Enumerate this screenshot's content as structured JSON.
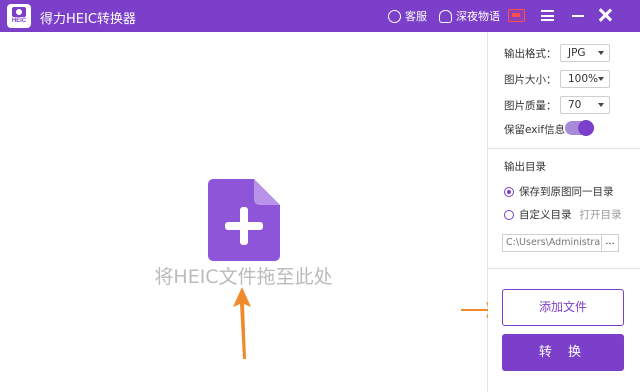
{
  "app": {
    "title": "得力HEIC转换器",
    "logo_text": "HEIC",
    "accent_color": "#7b3fc9"
  },
  "titlebar": {
    "support_label": "客服",
    "theme_label": "深夜物语",
    "icons": [
      "chat-icon",
      "user-icon",
      "vip-badge-icon",
      "menu-icon",
      "minimize-icon",
      "close-icon"
    ]
  },
  "dropzone": {
    "text": "将HEIC文件拖至此处",
    "icon": "file-add-icon"
  },
  "settings": {
    "format_label": "输出格式：",
    "format_value": "JPG",
    "size_label": "图片大小：",
    "size_value": "100%",
    "quality_label": "图片质量：",
    "quality_value": "70",
    "exif_label": "保留exif信息",
    "exif_on": true
  },
  "output": {
    "title": "输出目录",
    "option_same": "保存到原图同一目录",
    "option_custom": "自定义目录",
    "open_dir": "打开目录",
    "path": "C:\\Users\\Administra",
    "browse": "..."
  },
  "actions": {
    "add_label": "添加文件",
    "convert_label": "转 换"
  }
}
